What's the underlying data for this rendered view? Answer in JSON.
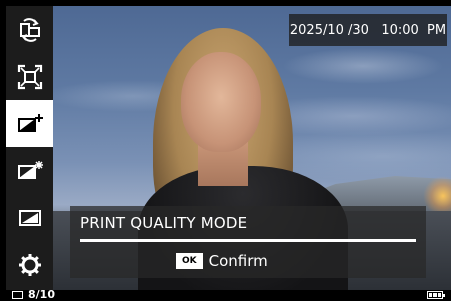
{
  "sidebar": {
    "items": [
      {
        "icon": "rotate-icon",
        "selected": false
      },
      {
        "icon": "crop-frame-icon",
        "selected": false
      },
      {
        "icon": "print-quality-icon",
        "selected": true
      },
      {
        "icon": "image-enhance-icon",
        "selected": false
      },
      {
        "icon": "frame-border-icon",
        "selected": false
      },
      {
        "icon": "gear-icon",
        "selected": false
      }
    ]
  },
  "datetime": "2025/10 /30   10:00  PM",
  "dialog": {
    "title": "PRINT QUALITY MODE",
    "ok_chip": "OK",
    "confirm_label": "Confirm"
  },
  "status": {
    "counter": "8/10",
    "battery_level": "full"
  },
  "colors": {
    "sidebar_bg": "#1c1c1c",
    "selected_bg": "#ffffff",
    "overlay_bg": "#282828"
  }
}
